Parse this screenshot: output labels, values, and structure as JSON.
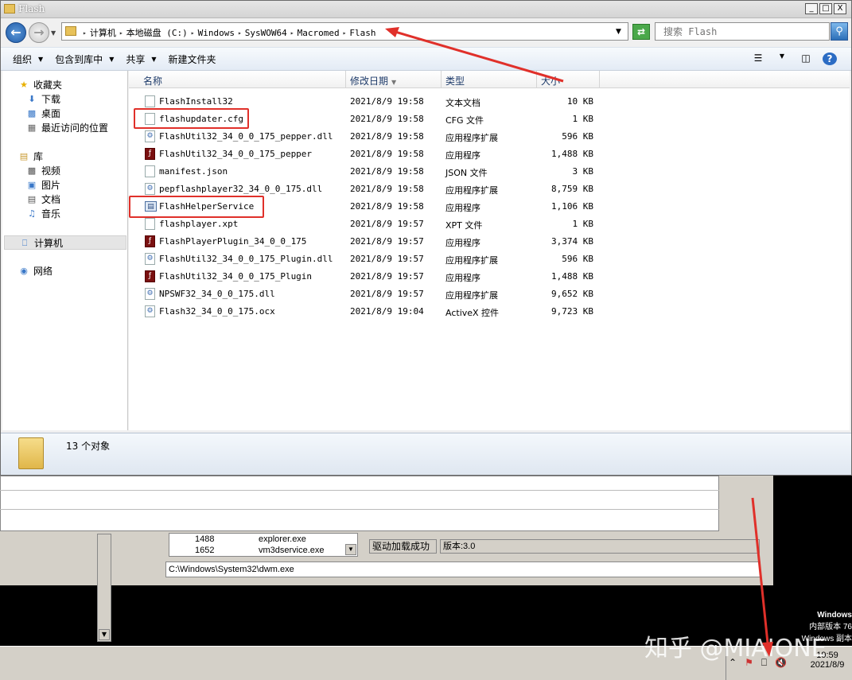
{
  "window": {
    "title": "Flash"
  },
  "titlebar_buttons": [
    "_",
    "□",
    "X"
  ],
  "address": {
    "crumbs": [
      "计算机",
      "本地磁盘 (C:)",
      "Windows",
      "SysWOW64",
      "Macromed",
      "Flash"
    ]
  },
  "search": {
    "placeholder": "搜索 Flash"
  },
  "toolbar": {
    "items": [
      {
        "label": "组织",
        "dropdown": true
      },
      {
        "label": "包含到库中",
        "dropdown": true
      },
      {
        "label": "共享",
        "dropdown": true
      },
      {
        "label": "新建文件夹",
        "dropdown": false
      }
    ]
  },
  "nav": {
    "favorites": {
      "label": "收藏夹",
      "items": [
        "下载",
        "桌面",
        "最近访问的位置"
      ]
    },
    "libraries": {
      "label": "库",
      "items": [
        "视频",
        "图片",
        "文档",
        "音乐"
      ]
    },
    "computer": "计算机",
    "network": "网络"
  },
  "columns": {
    "name": "名称",
    "modified": "修改日期",
    "type": "类型",
    "size": "大小"
  },
  "files": [
    {
      "name": "FlashInstall32",
      "date": "2021/8/9 19:58",
      "type": "文本文档",
      "size": "10 KB",
      "icon": "text"
    },
    {
      "name": "flashupdater.cfg",
      "date": "2021/8/9 19:58",
      "type": "CFG 文件",
      "size": "1 KB",
      "icon": "file"
    },
    {
      "name": "FlashUtil32_34_0_0_175_pepper.dll",
      "date": "2021/8/9 19:58",
      "type": "应用程序扩展",
      "size": "596 KB",
      "icon": "dll"
    },
    {
      "name": "FlashUtil32_34_0_0_175_pepper",
      "date": "2021/8/9 19:58",
      "type": "应用程序",
      "size": "1,488 KB",
      "icon": "flash"
    },
    {
      "name": "manifest.json",
      "date": "2021/8/9 19:58",
      "type": "JSON 文件",
      "size": "3 KB",
      "icon": "file"
    },
    {
      "name": "pepflashplayer32_34_0_0_175.dll",
      "date": "2021/8/9 19:58",
      "type": "应用程序扩展",
      "size": "8,759 KB",
      "icon": "dll"
    },
    {
      "name": "FlashHelperService",
      "date": "2021/8/9 19:58",
      "type": "应用程序",
      "size": "1,106 KB",
      "icon": "service"
    },
    {
      "name": "flashplayer.xpt",
      "date": "2021/8/9 19:57",
      "type": "XPT 文件",
      "size": "1 KB",
      "icon": "file"
    },
    {
      "name": "FlashPlayerPlugin_34_0_0_175",
      "date": "2021/8/9 19:57",
      "type": "应用程序",
      "size": "3,374 KB",
      "icon": "flash"
    },
    {
      "name": "FlashUtil32_34_0_0_175_Plugin.dll",
      "date": "2021/8/9 19:57",
      "type": "应用程序扩展",
      "size": "596 KB",
      "icon": "dll"
    },
    {
      "name": "FlashUtil32_34_0_0_175_Plugin",
      "date": "2021/8/9 19:57",
      "type": "应用程序",
      "size": "1,488 KB",
      "icon": "flash"
    },
    {
      "name": "NPSWF32_34_0_0_175.dll",
      "date": "2021/8/9 19:57",
      "type": "应用程序扩展",
      "size": "9,652 KB",
      "icon": "dll"
    },
    {
      "name": "Flash32_34_0_0_175.ocx",
      "date": "2021/8/9 19:04",
      "type": "ActiveX 控件",
      "size": "9,723 KB",
      "icon": "dll"
    }
  ],
  "status": {
    "count_text": "13 个对象"
  },
  "background_window": {
    "processes": [
      {
        "pid": "1488",
        "name": "explorer.exe"
      },
      {
        "pid": "1652",
        "name": "vm3dservice.exe"
      }
    ],
    "driver_status": "驱动加载成功",
    "version": "版本:3.0",
    "path": "C:\\Windows\\System32\\dwm.exe"
  },
  "desktop_text": {
    "line1": "Windows",
    "line2": "内部版本 76",
    "line3": "Windows 副本不是正"
  },
  "watermark": "知乎 @MIAIONE",
  "clock": {
    "time": "19:59",
    "date": "2021/8/9"
  },
  "colors": {
    "highlight": "#e0302a",
    "accent": "#1e5aa8"
  }
}
